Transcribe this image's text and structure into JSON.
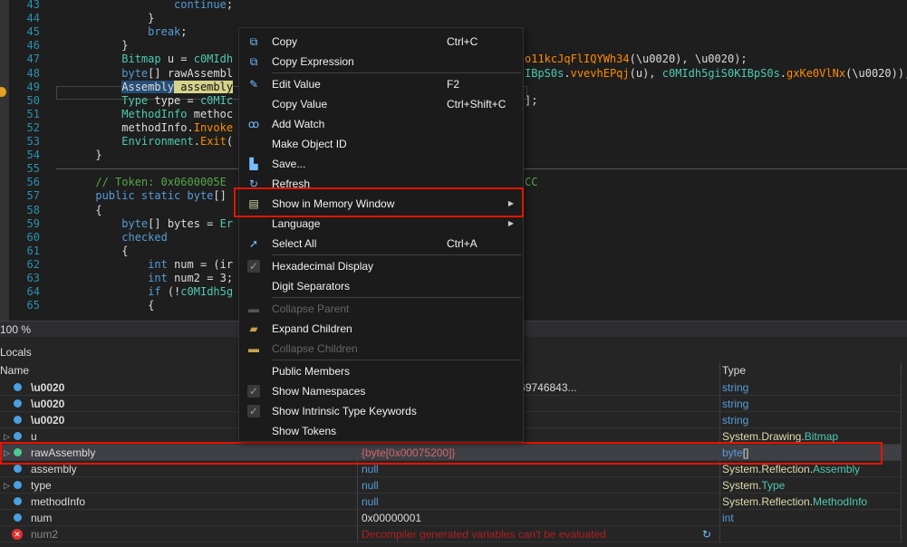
{
  "editor": {
    "lines": [
      {
        "n": "43",
        "parts": [
          [
            "tx",
            "                  "
          ],
          [
            "kw",
            "continue"
          ],
          [
            "tx",
            ";"
          ]
        ]
      },
      {
        "n": "44",
        "parts": [
          [
            "tx",
            "              }"
          ]
        ]
      },
      {
        "n": "45",
        "parts": [
          [
            "tx",
            "              "
          ],
          [
            "kw",
            "break"
          ],
          [
            "tx",
            ";"
          ]
        ]
      },
      {
        "n": "46",
        "parts": [
          [
            "tx",
            "          }"
          ]
        ]
      },
      {
        "n": "47",
        "parts": [
          [
            "tx",
            "          "
          ],
          [
            "ty",
            "Bitmap"
          ],
          [
            "tx",
            " u = "
          ],
          [
            "ty",
            "c0MIdh"
          ]
        ],
        "tail": [
          [
            "mt",
            "o11kcJqFlIQYWh34"
          ],
          [
            "tx",
            "(\\u0020), \\u0020);"
          ]
        ]
      },
      {
        "n": "48",
        "parts": [
          [
            "tx",
            "          "
          ],
          [
            "kw",
            "byte"
          ],
          [
            "tx",
            "[] rawAssembl"
          ]
        ],
        "tail": [
          [
            "ty",
            "IBpS0s"
          ],
          [
            "tx",
            "."
          ],
          [
            "mt",
            "vvevhEPqj"
          ],
          [
            "tx",
            "(u), "
          ],
          [
            "ty",
            "c0MIdh5giS0KIBpS0s"
          ],
          [
            "tx",
            "."
          ],
          [
            "mt",
            "gxKe0VlNx"
          ],
          [
            "tx",
            "(\\u0020));"
          ]
        ]
      },
      {
        "n": "49",
        "parts": [
          [
            "tx",
            "          "
          ],
          [
            "hl1",
            "Assembly"
          ],
          [
            "hl2",
            " assembly"
          ]
        ]
      },
      {
        "n": "50",
        "parts": [
          [
            "tx",
            "          "
          ],
          [
            "ty",
            "Type"
          ],
          [
            "tx",
            " type = "
          ],
          [
            "ty",
            "c0MIc"
          ]
        ],
        "tail": [
          [
            "tx",
            "];"
          ]
        ]
      },
      {
        "n": "51",
        "parts": [
          [
            "tx",
            "          "
          ],
          [
            "ty",
            "MethodInfo"
          ],
          [
            "tx",
            " methoc"
          ]
        ]
      },
      {
        "n": "52",
        "parts": [
          [
            "tx",
            "          methodInfo."
          ],
          [
            "mt",
            "Invoke"
          ]
        ]
      },
      {
        "n": "53",
        "parts": [
          [
            "tx",
            "          "
          ],
          [
            "ty",
            "Environment"
          ],
          [
            "tx",
            "."
          ],
          [
            "mt",
            "Exit"
          ],
          [
            "tx",
            "("
          ]
        ]
      },
      {
        "n": "54",
        "parts": [
          [
            "tx",
            "      }"
          ]
        ]
      },
      {
        "n": "55",
        "parts": []
      },
      {
        "n": "56",
        "parts": [
          [
            "tx",
            "      "
          ],
          [
            "cm",
            "// Token: 0x0600005E"
          ]
        ],
        "tail": [
          [
            "cm",
            "CC"
          ]
        ]
      },
      {
        "n": "57",
        "parts": [
          [
            "tx",
            "      "
          ],
          [
            "kw",
            "public static byte"
          ],
          [
            "tx",
            "[]"
          ]
        ]
      },
      {
        "n": "58",
        "parts": [
          [
            "tx",
            "      {"
          ]
        ]
      },
      {
        "n": "59",
        "parts": [
          [
            "tx",
            "          "
          ],
          [
            "kw",
            "byte"
          ],
          [
            "tx",
            "[] bytes = "
          ],
          [
            "ty",
            "Er"
          ]
        ]
      },
      {
        "n": "60",
        "parts": [
          [
            "tx",
            "          "
          ],
          [
            "kw",
            "checked"
          ]
        ]
      },
      {
        "n": "61",
        "parts": [
          [
            "tx",
            "          {"
          ]
        ]
      },
      {
        "n": "62",
        "parts": [
          [
            "tx",
            "              "
          ],
          [
            "kw",
            "int"
          ],
          [
            "tx",
            " num = (ir"
          ]
        ]
      },
      {
        "n": "63",
        "parts": [
          [
            "tx",
            "              "
          ],
          [
            "kw",
            "int"
          ],
          [
            "tx",
            " num2 = 3;"
          ]
        ]
      },
      {
        "n": "64",
        "parts": [
          [
            "tx",
            "              "
          ],
          [
            "kw",
            "if"
          ],
          [
            "tx",
            " (!"
          ],
          [
            "ty",
            "c0MIdh5g"
          ]
        ]
      },
      {
        "n": "65",
        "parts": [
          [
            "tx",
            "              {"
          ]
        ]
      }
    ],
    "zoom": "100 %"
  },
  "menu": {
    "items": [
      {
        "label": "Copy",
        "shortcut": "Ctrl+C",
        "icon": "copy-icon",
        "glyph": "⧉"
      },
      {
        "label": "Copy Expression",
        "shortcut": "",
        "icon": "copy-icon",
        "glyph": "⧉"
      },
      {
        "label": "Edit Value",
        "shortcut": "F2",
        "icon": "pencil-icon",
        "glyph": "✎"
      },
      {
        "label": "Copy Value",
        "shortcut": "Ctrl+Shift+C",
        "icon": "",
        "glyph": ""
      },
      {
        "label": "Add Watch",
        "shortcut": "",
        "icon": "glasses-icon",
        "glyph": "ꝏ"
      },
      {
        "label": "Make Object ID",
        "shortcut": "",
        "icon": "",
        "glyph": ""
      },
      {
        "label": "Save...",
        "shortcut": "",
        "icon": "save-icon",
        "glyph": "▙"
      },
      {
        "label": "Refresh",
        "shortcut": "",
        "icon": "refresh-icon",
        "glyph": "↻"
      },
      {
        "label": "Show in Memory Window",
        "shortcut": "",
        "icon": "memory-chip-icon",
        "glyph": "▤",
        "submenu": true
      },
      {
        "label": "Language",
        "shortcut": "",
        "icon": "",
        "glyph": "",
        "submenu": true
      },
      {
        "label": "Select All",
        "shortcut": "Ctrl+A",
        "icon": "select-cursor-icon",
        "glyph": "➚"
      },
      {
        "label": "Hexadecimal Display",
        "shortcut": "",
        "icon": "check-icon",
        "glyph": "✓",
        "checked": true
      },
      {
        "label": "Digit Separators",
        "shortcut": "",
        "icon": "",
        "glyph": ""
      },
      {
        "label": "Collapse Parent",
        "shortcut": "",
        "icon": "collapse-parent-icon",
        "glyph": "▬",
        "disabled": true
      },
      {
        "label": "Expand Children",
        "shortcut": "",
        "icon": "folder-open-icon",
        "glyph": "▰"
      },
      {
        "label": "Collapse Children",
        "shortcut": "",
        "icon": "folder-icon",
        "glyph": "▬",
        "disabled": true
      },
      {
        "label": "Public Members",
        "shortcut": "",
        "icon": "",
        "glyph": ""
      },
      {
        "label": "Show Namespaces",
        "shortcut": "",
        "icon": "check-icon",
        "glyph": "✓",
        "checked": true
      },
      {
        "label": "Show Intrinsic Type Keywords",
        "shortcut": "",
        "icon": "check-icon",
        "glyph": "✓",
        "checked": true
      },
      {
        "label": "Show Tokens",
        "shortcut": "",
        "icon": "",
        "glyph": ""
      }
    ]
  },
  "locals": {
    "title": "Locals",
    "columns": [
      "Name",
      "Value",
      "Type"
    ],
    "rows": [
      {
        "name": "\\u0020",
        "value": "96F6E546F6B656E4C6973745769746843...",
        "type": [
          [
            "kw",
            "string"
          ]
        ],
        "bold": true
      },
      {
        "name": "\\u0020",
        "value": "",
        "type": [
          [
            "kw",
            "string"
          ]
        ],
        "bold": true
      },
      {
        "name": "\\u0020",
        "value": "",
        "type": [
          [
            "kw",
            "string"
          ]
        ],
        "bold": true
      },
      {
        "name": "u",
        "value": "",
        "type": [
          [
            "ns",
            "System.Drawing."
          ],
          [
            "tn",
            "Bitmap"
          ]
        ],
        "expand": true
      },
      {
        "name": "rawAssembly",
        "value": "{byte[0x00075200]}",
        "type": [
          [
            "kw",
            "byte"
          ],
          [
            "tx",
            "[]"
          ]
        ],
        "expand": true,
        "selected": true
      },
      {
        "name": "assembly",
        "value": "null",
        "type": [
          [
            "ns",
            "System.Reflection."
          ],
          [
            "tn",
            "Assembly"
          ]
        ]
      },
      {
        "name": "type",
        "value": "null",
        "type": [
          [
            "ns",
            "System."
          ],
          [
            "tn",
            "Type"
          ]
        ],
        "expand": true
      },
      {
        "name": "methodInfo",
        "value": "null",
        "type": [
          [
            "ns",
            "System.Reflection."
          ],
          [
            "tn",
            "MethodInfo"
          ]
        ]
      },
      {
        "name": "num",
        "value": "0x00000001",
        "type": [
          [
            "kw",
            "int"
          ]
        ]
      },
      {
        "name": "num2",
        "value": "Decompiler generated variables can't be evaluated",
        "type": [],
        "error": true
      }
    ]
  },
  "colors": {
    "highlight_box": "#e51400",
    "keyword": "#569cd6",
    "type": "#4ec9b0",
    "method": "#ff8c00",
    "comment": "#57a64a"
  }
}
